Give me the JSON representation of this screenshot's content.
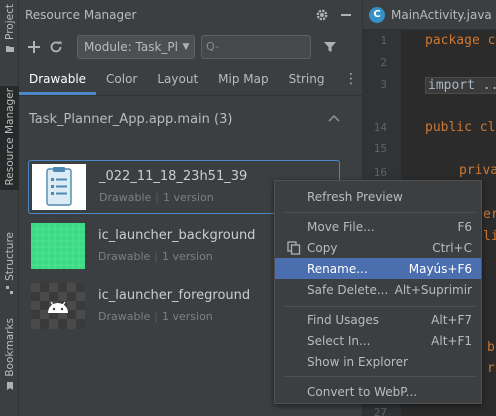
{
  "side_tabs": {
    "project": "Project",
    "resource_manager": "Resource Manager",
    "structure": "Structure",
    "bookmarks": "Bookmarks"
  },
  "panel": {
    "title": "Resource Manager",
    "module_select": "Module: Task_Pla",
    "search_placeholder": "Q-",
    "tabs": [
      {
        "label": "Drawable",
        "active": true
      },
      {
        "label": "Color"
      },
      {
        "label": "Layout"
      },
      {
        "label": "Mip Map"
      },
      {
        "label": "String"
      }
    ],
    "section_title": "Task_Planner_App.app.main (3)",
    "assets": [
      {
        "name": "_022_11_18_23h51_39",
        "type": "Drawable",
        "version": "1 version"
      },
      {
        "name": "ic_launcher_background",
        "type": "Drawable",
        "version": "1 version"
      },
      {
        "name": "ic_launcher_foreground",
        "type": "Drawable",
        "version": "1 version"
      }
    ]
  },
  "editor": {
    "tab_name": "MainActivity.java",
    "line_numbers": [
      "1",
      "2",
      "3",
      "14",
      "15",
      "16",
      "27"
    ],
    "lines": [
      "package c",
      "import ...",
      "public cl",
      "priva",
      "er",
      "li",
      "b",
      "r"
    ]
  },
  "context_menu": {
    "items": [
      {
        "label": "Refresh Preview",
        "shortcut": ""
      },
      {
        "label": "Move File...",
        "shortcut": "F6"
      },
      {
        "label": "Copy",
        "shortcut": "Ctrl+C"
      },
      {
        "label": "Rename...",
        "shortcut": "Mayús+F6"
      },
      {
        "label": "Safe Delete...",
        "shortcut": "Alt+Suprimir"
      },
      {
        "label": "Find Usages",
        "shortcut": "Alt+F7"
      },
      {
        "label": "Select In...",
        "shortcut": "Alt+F1"
      },
      {
        "label": "Show in Explorer",
        "shortcut": ""
      },
      {
        "label": "Convert to WebP...",
        "shortcut": ""
      }
    ]
  },
  "colors": {
    "accent": "#4a88c7",
    "menu_highlight": "#4b6eaf",
    "panel_bg": "#3c3f41",
    "editor_bg": "#2b2b2b",
    "keyword": "#cc7832",
    "launcher_green": "#3ddc84"
  }
}
